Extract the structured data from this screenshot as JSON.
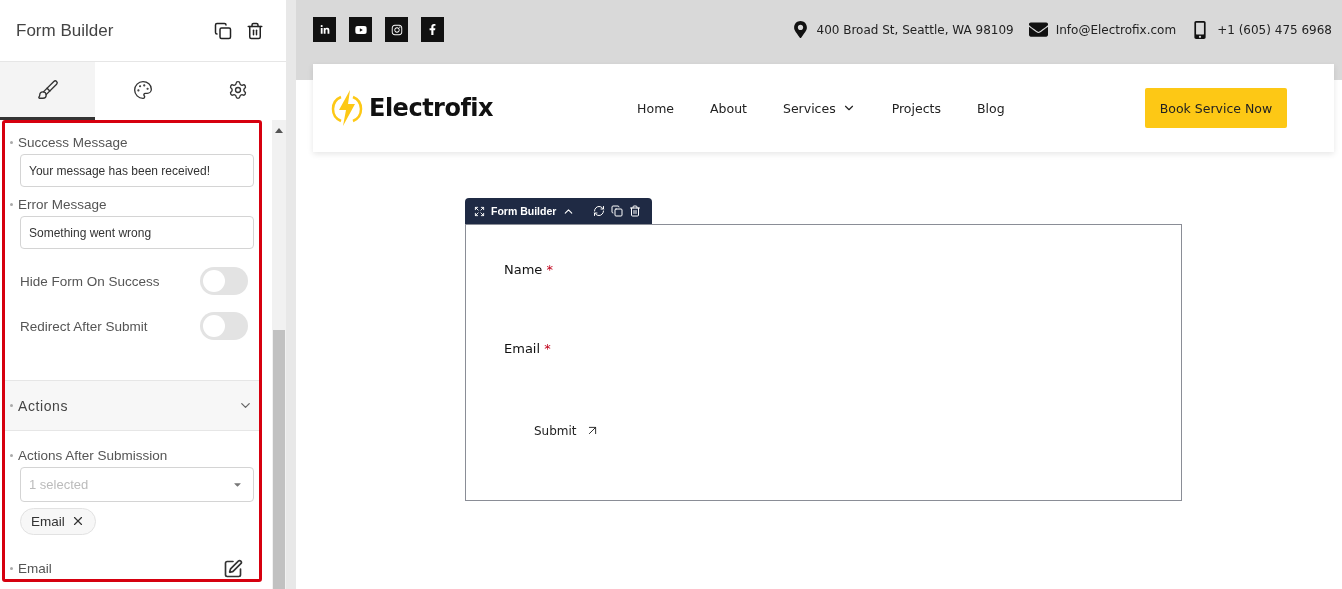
{
  "panel": {
    "title": "Form Builder",
    "tabs": [
      {
        "kind": "content",
        "selected": true
      },
      {
        "kind": "style",
        "selected": false
      },
      {
        "kind": "advanced",
        "selected": false
      }
    ],
    "fields": [
      {
        "kind": "text",
        "label": "Success Message",
        "value": "Your message has been received!"
      },
      {
        "kind": "text",
        "label": "Error Message",
        "value": "Something went wrong"
      },
      {
        "kind": "toggle",
        "label": "Hide Form On Success",
        "on": false
      },
      {
        "kind": "toggle",
        "label": "Redirect After Submit",
        "on": false
      }
    ],
    "section": {
      "title": "Actions",
      "expanded": true
    },
    "actions_field": {
      "label": "Actions After Submission",
      "placeholder": "1 selected",
      "tags": [
        "Email"
      ]
    },
    "edit_row": {
      "label": "Email"
    }
  },
  "site": {
    "social": [
      {
        "kind": "linkedin"
      },
      {
        "kind": "youtube"
      },
      {
        "kind": "instagram"
      },
      {
        "kind": "facebook"
      }
    ],
    "contacts": [
      {
        "kind": "location",
        "text": "400 Broad St, Seattle, WA 98109"
      },
      {
        "kind": "email",
        "text": "Info@Electrofix.com"
      },
      {
        "kind": "phone",
        "text": "+1 (605) 475 6968"
      }
    ],
    "brand": "Electrofix",
    "nav": [
      {
        "label": "Home",
        "dropdown": false
      },
      {
        "label": "About",
        "dropdown": false
      },
      {
        "label": "Services",
        "dropdown": true
      },
      {
        "label": "Projects",
        "dropdown": false
      },
      {
        "label": "Blog",
        "dropdown": false
      }
    ],
    "cta": "Book Service Now"
  },
  "widget": {
    "title": "Form Builder",
    "fields": [
      {
        "label": "Name",
        "required_mark": "*"
      },
      {
        "label": "Email",
        "required_mark": "*"
      }
    ],
    "submit": "Submit"
  }
}
